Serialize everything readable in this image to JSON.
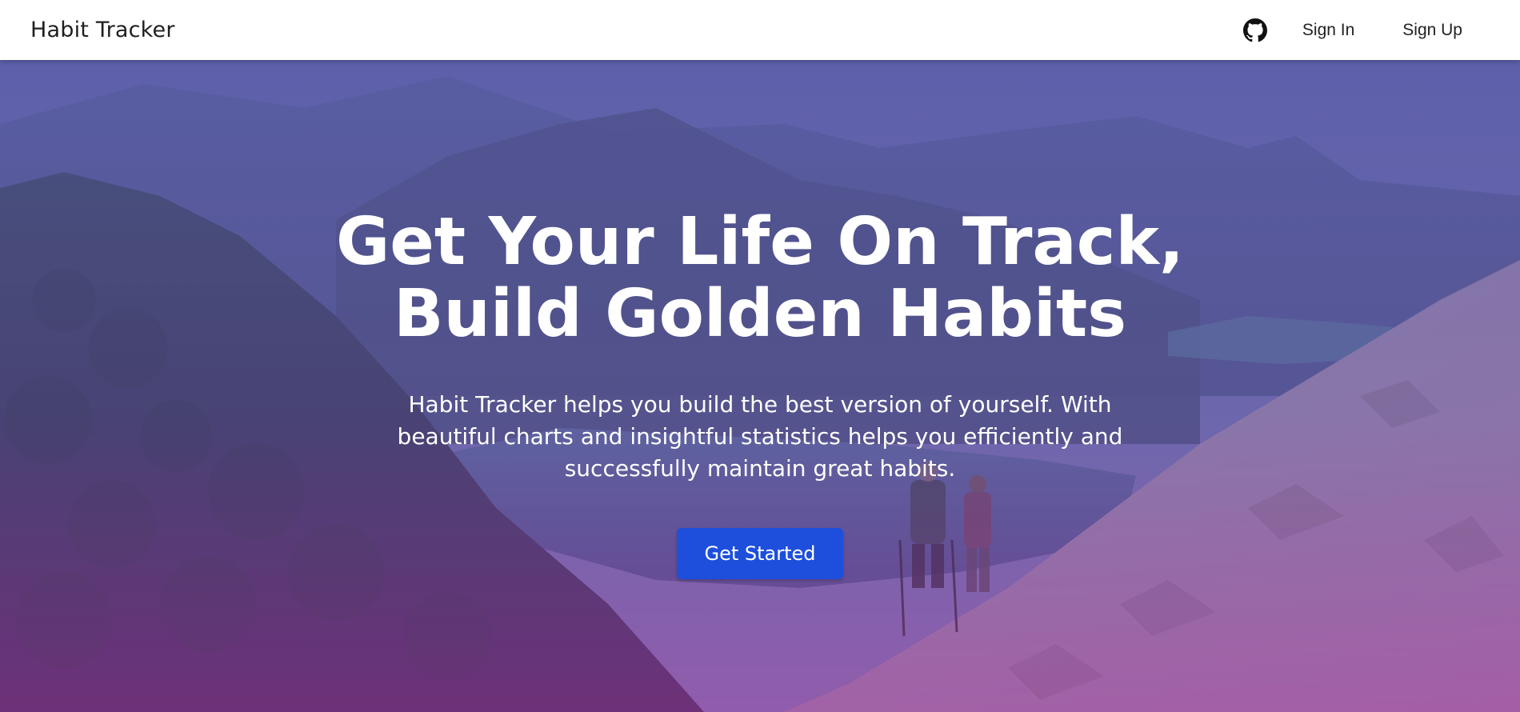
{
  "nav": {
    "brand": "Habit Tracker",
    "github_icon": "github-icon",
    "signin_label": "Sign In",
    "signup_label": "Sign Up"
  },
  "hero": {
    "headline_line1": "Get Your Life On Track,",
    "headline_line2": "Build Golden Habits",
    "subtitle": "Habit Tracker helps you build the best version of yourself. With beautiful charts and insightful statistics helps you efficiently and successfully maintain great habits.",
    "cta_label": "Get Started",
    "background": "mountain hiking landscape with purple overlay"
  },
  "colors": {
    "cta": "#1d4fdc",
    "overlay_top": "#5a5aa0",
    "overlay_bottom": "#9a3a9a"
  }
}
